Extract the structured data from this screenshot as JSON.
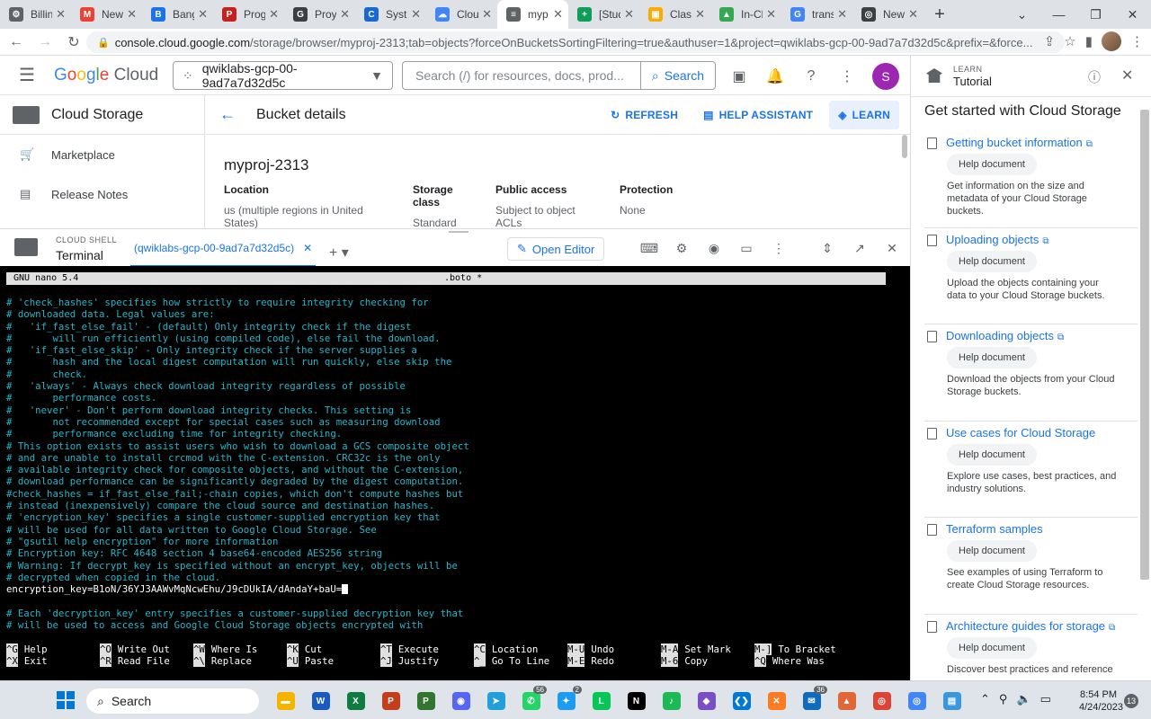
{
  "browser": {
    "tabs": [
      {
        "label": "Billin",
        "color": "#5f6368",
        "glyph": "⚙"
      },
      {
        "label": "New",
        "color": "#ea4335",
        "glyph": "M"
      },
      {
        "label": "Bang",
        "color": "#1a73e8",
        "glyph": "B"
      },
      {
        "label": "Prog",
        "color": "#c5221f",
        "glyph": "P"
      },
      {
        "label": "Proy",
        "color": "#3c4043",
        "glyph": "G"
      },
      {
        "label": "Syste",
        "color": "#1967d2",
        "glyph": "C"
      },
      {
        "label": "Clou",
        "color": "#4285f4",
        "glyph": "☁"
      },
      {
        "label": "myp",
        "color": "#5f6368",
        "glyph": "≡",
        "active": true
      },
      {
        "label": "[Stud",
        "color": "#0f9d58",
        "glyph": "+"
      },
      {
        "label": "Class",
        "color": "#f9ab00",
        "glyph": "▣"
      },
      {
        "label": "In-Cl",
        "color": "#34a853",
        "glyph": "▲"
      },
      {
        "label": "trans",
        "color": "#4285f4",
        "glyph": "G"
      },
      {
        "label": "New",
        "color": "#3c4043",
        "glyph": "◎"
      }
    ],
    "url_host": "console.cloud.google.com",
    "url_path": "/storage/browser/myproj-2313;tab=objects?forceOnBucketsSortingFiltering=true&authuser=1&project=qwiklabs-gcp-00-9ad7a7d32d5c&prefix=&force..."
  },
  "gcp": {
    "logo_google": "Google",
    "logo_cloud": "Cloud",
    "project": "qwiklabs-gcp-00-9ad7a7d32d5c",
    "search_placeholder": "Search (/) for resources, docs, prod...",
    "search_button": "Search",
    "avatar_letter": "S"
  },
  "leftnav": {
    "title": "Cloud Storage",
    "items": [
      {
        "label": "Marketplace"
      },
      {
        "label": "Release Notes"
      }
    ]
  },
  "bucket": {
    "page_title": "Bucket details",
    "refresh": "REFRESH",
    "help_assistant": "HELP ASSISTANT",
    "learn": "LEARN",
    "name": "myproj-2313",
    "props": [
      {
        "key": "Location",
        "value": "us (multiple regions in United States)"
      },
      {
        "key": "Storage class",
        "value": "Standard"
      },
      {
        "key": "Public access",
        "value": "Subject to object ACLs"
      },
      {
        "key": "Protection",
        "value": "None"
      }
    ]
  },
  "shell": {
    "label_small": "CLOUD SHELL",
    "label_big": "Terminal",
    "tab_label": "(qwiklabs-gcp-00-9ad7a7d32d5c)",
    "open_editor": "Open Editor"
  },
  "nano": {
    "version": "GNU nano 5.4",
    "filename": ".boto *",
    "lines": [
      {
        "t": "# 'check_hashes' specifies how strictly to require integrity checking for"
      },
      {
        "t": "# downloaded data. Legal values are:"
      },
      {
        "t": "#   'if_fast_else_fail' - (default) Only integrity check if the digest"
      },
      {
        "t": "#       will run efficiently (using compiled code), else fail the download."
      },
      {
        "t": "#   'if_fast_else_skip' - Only integrity check if the server supplies a"
      },
      {
        "t": "#       hash and the local digest computation will run quickly, else skip the"
      },
      {
        "t": "#       check."
      },
      {
        "t": "#   'always' - Always check download integrity regardless of possible"
      },
      {
        "t": "#       performance costs."
      },
      {
        "t": "#   'never' - Don't perform download integrity checks. This setting is"
      },
      {
        "t": "#       not recommended except for special cases such as measuring download"
      },
      {
        "t": "#       performance excluding time for integrity checking."
      },
      {
        "t": "# This option exists to assist users who wish to download a GCS composite object"
      },
      {
        "t": "# and are unable to install crcmod with the C-extension. CRC32c is the only"
      },
      {
        "t": "# available integrity check for composite objects, and without the C-extension,"
      },
      {
        "t": "# download performance can be significantly degraded by the digest computation."
      },
      {
        "t": "#check_hashes = if_fast_else_fail;-chain copies, which don't compute hashes but"
      },
      {
        "t": "# instead (inexpensively) compare the cloud source and destination hashes."
      },
      {
        "t": "# 'encryption_key' specifies a single customer-supplied encryption key that"
      },
      {
        "t": "# will be used for all data written to Google Cloud Storage. See"
      },
      {
        "t": "# \"gsutil help encryption\" for more information"
      },
      {
        "t": "# Encryption key: RFC 4648 section 4 base64-encoded AES256 string"
      },
      {
        "t": "# Warning: If decrypt_key is specified without an encrypt_key, objects will be"
      },
      {
        "t": "# decrypted when copied in the cloud."
      },
      {
        "t": "encryption_key=B1oN/36YJ3AAWvMqNcwEhu/J9cDUkIA/dAndaY+baU=",
        "plain": true,
        "cursor": true
      },
      {
        "t": ""
      },
      {
        "t": "# Each 'decryption_key' entry specifies a customer-supplied decryption key that"
      },
      {
        "t": "# will be used to access and Google Cloud Storage objects encrypted with"
      }
    ],
    "help_row1": [
      {
        "key": "^G",
        "label": "Help"
      },
      {
        "key": "^O",
        "label": "Write Out"
      },
      {
        "key": "^W",
        "label": "Where Is"
      },
      {
        "key": "^K",
        "label": "Cut"
      },
      {
        "key": "^T",
        "label": "Execute"
      },
      {
        "key": "^C",
        "label": "Location"
      },
      {
        "key": "M-U",
        "label": "Undo"
      },
      {
        "key": "M-A",
        "label": "Set Mark"
      },
      {
        "key": "M-]",
        "label": "To Bracket"
      }
    ],
    "help_row2": [
      {
        "key": "^X",
        "label": "Exit"
      },
      {
        "key": "^R",
        "label": "Read File"
      },
      {
        "key": "^\\",
        "label": "Replace"
      },
      {
        "key": "^U",
        "label": "Paste"
      },
      {
        "key": "^J",
        "label": "Justify"
      },
      {
        "key": "^_",
        "label": "Go To Line"
      },
      {
        "key": "M-E",
        "label": "Redo"
      },
      {
        "key": "M-6",
        "label": "Copy"
      },
      {
        "key": "^Q",
        "label": "Where Was"
      }
    ]
  },
  "tutorial": {
    "label_small": "LEARN",
    "label_big": "Tutorial",
    "heading": "Get started with Cloud Storage",
    "items": [
      {
        "title": "Getting bucket information",
        "chip": "Help document",
        "desc": "Get information on the size and metadata of your Cloud Storage buckets.",
        "ext": true
      },
      {
        "title": "Uploading objects",
        "chip": "Help document",
        "desc": "Upload the objects containing your data to your Cloud Storage buckets.",
        "ext": true
      },
      {
        "title": "Downloading objects",
        "chip": "Help document",
        "desc": "Download the objects from your Cloud Storage buckets.",
        "ext": true
      },
      {
        "title": "Use cases for Cloud Storage",
        "chip": "Help document",
        "desc": "Explore use cases, best practices, and industry solutions.",
        "ext": false
      },
      {
        "title": "Terraform samples",
        "chip": "Help document",
        "desc": "See examples of using Terraform to create Cloud Storage resources.",
        "ext": false
      },
      {
        "title": "Architecture guides for storage",
        "chip": "Help document",
        "desc": "Discover best practices and reference",
        "ext": true
      }
    ]
  },
  "taskbar": {
    "search_label": "Search",
    "apps": [
      {
        "name": "file-explorer",
        "color": "#f4b400",
        "glyph": "▬"
      },
      {
        "name": "word",
        "color": "#185abd",
        "glyph": "W"
      },
      {
        "name": "excel",
        "color": "#107c41",
        "glyph": "X"
      },
      {
        "name": "powerpoint",
        "color": "#c43e1c",
        "glyph": "P"
      },
      {
        "name": "project",
        "color": "#31752f",
        "glyph": "P"
      },
      {
        "name": "discord",
        "color": "#5865f2",
        "glyph": "◉"
      },
      {
        "name": "telegram",
        "color": "#229ed9",
        "glyph": "➤"
      },
      {
        "name": "whatsapp",
        "color": "#25d366",
        "glyph": "✆",
        "badge": "56"
      },
      {
        "name": "twitter",
        "color": "#1d9bf0",
        "glyph": "✦",
        "badge": "2"
      },
      {
        "name": "line",
        "color": "#06c755",
        "glyph": "L"
      },
      {
        "name": "netflix",
        "color": "#000000",
        "glyph": "N"
      },
      {
        "name": "spotify",
        "color": "#1db954",
        "glyph": "♪"
      },
      {
        "name": "visual-studio",
        "color": "#7b4fc4",
        "glyph": "◆"
      },
      {
        "name": "vscode",
        "color": "#0078d4",
        "glyph": "❮❯"
      },
      {
        "name": "xampp",
        "color": "#fb7a24",
        "glyph": "✕"
      },
      {
        "name": "mail",
        "color": "#0f6cbd",
        "glyph": "✉",
        "badge": "36"
      },
      {
        "name": "matlab",
        "color": "#e16737",
        "glyph": "▲"
      },
      {
        "name": "chrome",
        "color": "#db4437",
        "glyph": "◎"
      },
      {
        "name": "chrome-2",
        "color": "#4285f4",
        "glyph": "◎"
      },
      {
        "name": "notepad",
        "color": "#3a96dd",
        "glyph": "▤"
      }
    ],
    "time": "8:54 PM",
    "date": "4/24/2023",
    "notifications": "13"
  }
}
